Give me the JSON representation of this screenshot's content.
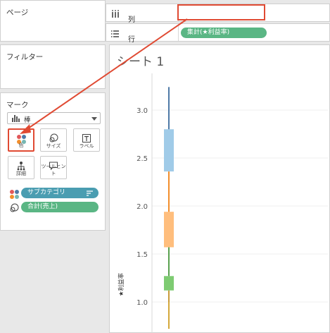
{
  "panels": {
    "pages": "ページ",
    "filters": "フィルター",
    "marks": "マーク"
  },
  "marks": {
    "type_label": "棒",
    "buttons": [
      {
        "label": "色",
        "icon": "color-dots-icon"
      },
      {
        "label": "サイズ",
        "icon": "size-icon"
      },
      {
        "label": "ラベル",
        "icon": "label-icon"
      },
      {
        "label": "詳細",
        "icon": "detail-icon"
      },
      {
        "label": "ツールヒント",
        "icon": "tooltip-icon"
      }
    ],
    "fields": [
      {
        "label": "サブカテゴリ",
        "icon": "color-dots-icon"
      },
      {
        "label": "合計(売上)",
        "icon": "size-icon"
      }
    ]
  },
  "shelves": {
    "columns_label": "列",
    "rows_label": "行",
    "rows_pill": "集計(★利益率)"
  },
  "sheet": {
    "title": "シート 1"
  },
  "colors": {
    "highlight": "#e04a33",
    "pill_blue": "#4a9db1",
    "pill_green": "#5ab684"
  },
  "chart_data": {
    "type": "bar",
    "orientation": "stacked-vertical",
    "ylabel": "★利益率",
    "yticks": [
      1.0,
      1.5,
      2.0,
      2.5,
      3.0
    ],
    "ylim": [
      0.85,
      3.4
    ],
    "segments": [
      {
        "from": 0.72,
        "to": 1.0,
        "color": "#d4a83a",
        "thick": false
      },
      {
        "from": 1.0,
        "to": 1.12,
        "color": "#c99b3a",
        "thick": false
      },
      {
        "from": 1.12,
        "to": 1.27,
        "color": "#7ecb72",
        "thick": true
      },
      {
        "from": 1.27,
        "to": 1.57,
        "color": "#59a14f",
        "thick": false
      },
      {
        "from": 1.57,
        "to": 1.94,
        "color": "#ffbe7d",
        "thick": true
      },
      {
        "from": 1.94,
        "to": 2.36,
        "color": "#f28e2b",
        "thick": false
      },
      {
        "from": 2.36,
        "to": 2.8,
        "color": "#a0cbe8",
        "thick": true
      },
      {
        "from": 2.8,
        "to": 3.24,
        "color": "#4e79a7",
        "thick": false
      }
    ]
  }
}
